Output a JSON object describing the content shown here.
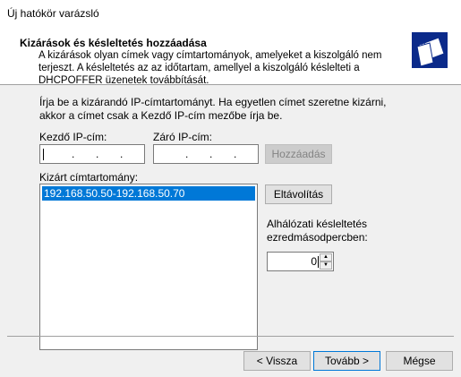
{
  "window": {
    "title": "Új hatókör varázsló"
  },
  "header": {
    "heading": "Kizárások és késleltetés hozzáadása",
    "description": "A kizárások olyan címek vagy címtartományok, amelyeket a kiszolgáló nem terjeszt. A késleltetés az az időtartam, amellyel a kiszolgáló késlelteti a DHCPOFFER üzenetek továbbítását.",
    "icon": "wizard-pages-icon"
  },
  "instructions": "Írja be a kizárandó IP-címtartományt. Ha egyetlen címet szeretne kizárni, akkor a címet csak a Kezdő IP-cím mezőbe írja be.",
  "start_ip": {
    "label": "Kezdő IP-cím:",
    "value": ". . ."
  },
  "end_ip": {
    "label": "Záró IP-cím:",
    "value": ". . ."
  },
  "buttons": {
    "add": "Hozzáadás",
    "remove": "Eltávolítás",
    "back": "< Vissza",
    "next": "Tovább >",
    "cancel": "Mégse"
  },
  "excluded": {
    "label": "Kizárt címtartomány:",
    "items": [
      "192.168.50.50-192.168.50.70"
    ]
  },
  "delay": {
    "label_line1": "Alhálózati késleltetés",
    "label_line2": "ezredmásodpercben:",
    "value": "0"
  }
}
